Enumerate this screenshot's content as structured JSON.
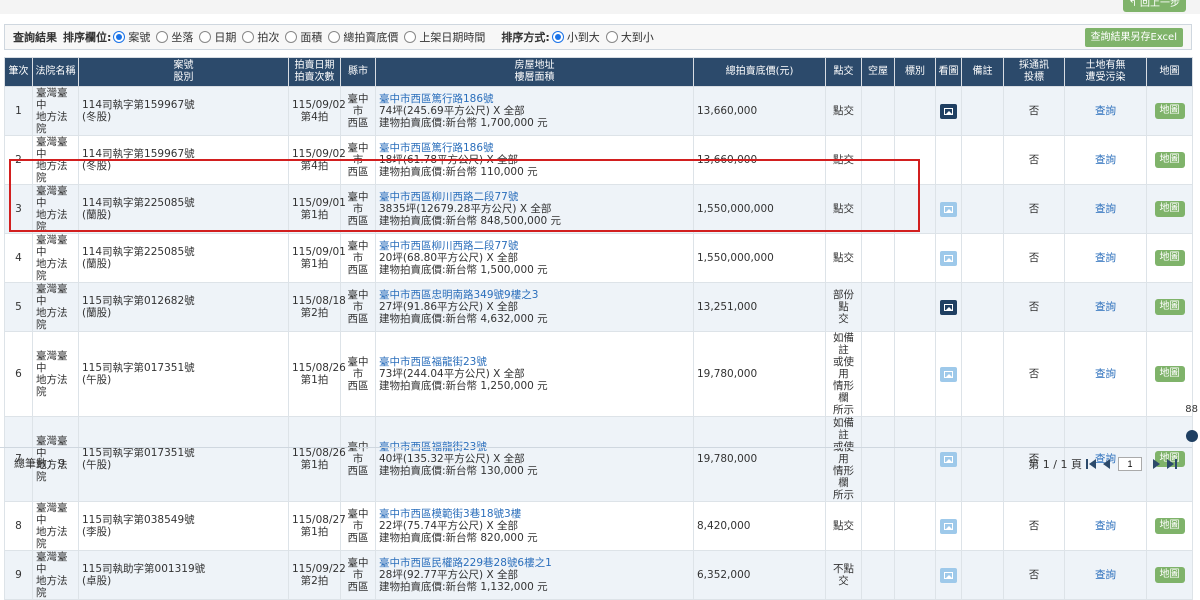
{
  "top": {
    "back_label": "回上一步"
  },
  "filter": {
    "title": "查詢結果",
    "sort_field_label": "排序欄位:",
    "sort_fields": [
      {
        "label": "案號",
        "selected": true
      },
      {
        "label": "坐落",
        "selected": false
      },
      {
        "label": "日期",
        "selected": false
      },
      {
        "label": "拍次",
        "selected": false
      },
      {
        "label": "面積",
        "selected": false
      },
      {
        "label": "總拍賣底價",
        "selected": false
      },
      {
        "label": "上架日期時間",
        "selected": false
      }
    ],
    "sort_order_label": "排序方式:",
    "sort_orders": [
      {
        "label": "小到大",
        "selected": true
      },
      {
        "label": "大到小",
        "selected": false
      }
    ],
    "excel_label": "查詢結果另存Excel"
  },
  "table": {
    "headers": {
      "no": "筆次",
      "court": "法院名稱",
      "case": "案號\n股別",
      "date": "拍賣日期\n拍賣次數",
      "city": "縣市",
      "address": "房屋地址\n樓層面積",
      "price": "總拍賣底價(元)",
      "handover": "點交",
      "vacant": "空屋",
      "type": "標別",
      "photo": "看圖",
      "note": "備註",
      "notice": "採通訊\n投標",
      "land": "土地有無\n遭受污染",
      "map": "地圖"
    },
    "query_label": "查詢",
    "map_label": "地圖",
    "rows": [
      {
        "no": "1",
        "court": "臺灣臺中\n地方法院",
        "case": "114司執字第159967號\n(冬股)",
        "date": "115/09/02\n第4拍",
        "city": "臺中市\n西區",
        "addr": "臺中市西區篤行路186號",
        "area": "74坪(245.69平方公尺) X 全部",
        "bprice": "建物拍賣底價:新台幣 1,700,000 元",
        "price": "13,660,000",
        "handover": "點交",
        "notice": "否",
        "photo": "dark"
      },
      {
        "no": "2",
        "court": "臺灣臺中\n地方法院",
        "case": "114司執字第159967號\n(冬股)",
        "date": "115/09/02\n第4拍",
        "city": "臺中市\n西區",
        "addr": "臺中市西區篤行路186號",
        "area": "18坪(61.78平方公尺) X 全部",
        "bprice": "建物拍賣底價:新台幣 110,000 元",
        "price": "13,660,000",
        "handover": "點交",
        "notice": "否",
        "photo": "none"
      },
      {
        "no": "3",
        "court": "臺灣臺中\n地方法院",
        "case": "114司執字第225085號\n(蘭股)",
        "date": "115/09/01\n第1拍",
        "city": "臺中市\n西區",
        "addr": "臺中市西區柳川西路二段77號",
        "area": "3835坪(12679.28平方公尺) X 全部",
        "bprice": "建物拍賣底價:新台幣 848,500,000 元",
        "price": "1,550,000,000",
        "handover": "點交",
        "notice": "否",
        "photo": "lite"
      },
      {
        "no": "4",
        "court": "臺灣臺中\n地方法院",
        "case": "114司執字第225085號\n(蘭股)",
        "date": "115/09/01\n第1拍",
        "city": "臺中市\n西區",
        "addr": "臺中市西區柳川西路二段77號",
        "area": "20坪(68.80平方公尺) X 全部",
        "bprice": "建物拍賣底價:新台幣 1,500,000 元",
        "price": "1,550,000,000",
        "handover": "點交",
        "notice": "否",
        "photo": "lite"
      },
      {
        "no": "5",
        "court": "臺灣臺中\n地方法院",
        "case": "115司執字第012682號\n(蘭股)",
        "date": "115/08/18\n第2拍",
        "city": "臺中市\n西區",
        "addr": "臺中市西區忠明南路349號9樓之3",
        "area": "27坪(91.86平方公尺) X 全部",
        "bprice": "建物拍賣底價:新台幣 4,632,000 元",
        "price": "13,251,000",
        "handover": "部份點\n交",
        "notice": "否",
        "photo": "dark"
      },
      {
        "no": "6",
        "court": "臺灣臺中\n地方法院",
        "case": "115司執字第017351號\n(午股)",
        "date": "115/08/26\n第1拍",
        "city": "臺中市\n西區",
        "addr": "臺中市西區福龍街23號",
        "area": "73坪(244.04平方公尺) X 全部",
        "bprice": "建物拍賣底價:新台幣 1,250,000 元",
        "price": "19,780,000",
        "handover": "如備註\n或使用\n情形欄\n所示",
        "notice": "否",
        "photo": "lite"
      },
      {
        "no": "7",
        "court": "臺灣臺中\n地方法院",
        "case": "115司執字第017351號\n(午股)",
        "date": "115/08/26\n第1拍",
        "city": "臺中市\n西區",
        "addr": "臺中市西區福龍街23號",
        "area": "40坪(135.32平方公尺) X 全部",
        "bprice": "建物拍賣底價:新台幣 130,000 元",
        "price": "19,780,000",
        "handover": "如備註\n或使用\n情形欄\n所示",
        "notice": "否",
        "photo": "lite"
      },
      {
        "no": "8",
        "court": "臺灣臺中\n地方法院",
        "case": "115司執字第038549號\n(李股)",
        "date": "115/08/27\n第1拍",
        "city": "臺中市\n西區",
        "addr": "臺中市西區模範街3巷18號3樓",
        "area": "22坪(75.74平方公尺) X 全部",
        "bprice": "建物拍賣底價:新台幣 820,000 元",
        "price": "8,420,000",
        "handover": "點交",
        "notice": "否",
        "photo": "lite"
      },
      {
        "no": "9",
        "court": "臺灣臺中\n地方法院",
        "case": "115司執助字第001319號\n(卓股)",
        "date": "115/09/22\n第2拍",
        "city": "臺中市\n西區",
        "addr": "臺中市西區民權路229巷28號6樓之1",
        "area": "28坪(92.77平方公尺) X 全部",
        "bprice": "建物拍賣底價:新台幣 1,132,000 元",
        "price": "6,352,000",
        "handover": "不點交",
        "notice": "否",
        "photo": "lite"
      }
    ]
  },
  "footer": {
    "total_label": "總筆數：9",
    "page_label": "第 1 / 1 頁",
    "page_value": "1"
  },
  "side": {
    "icon_text": "88"
  }
}
